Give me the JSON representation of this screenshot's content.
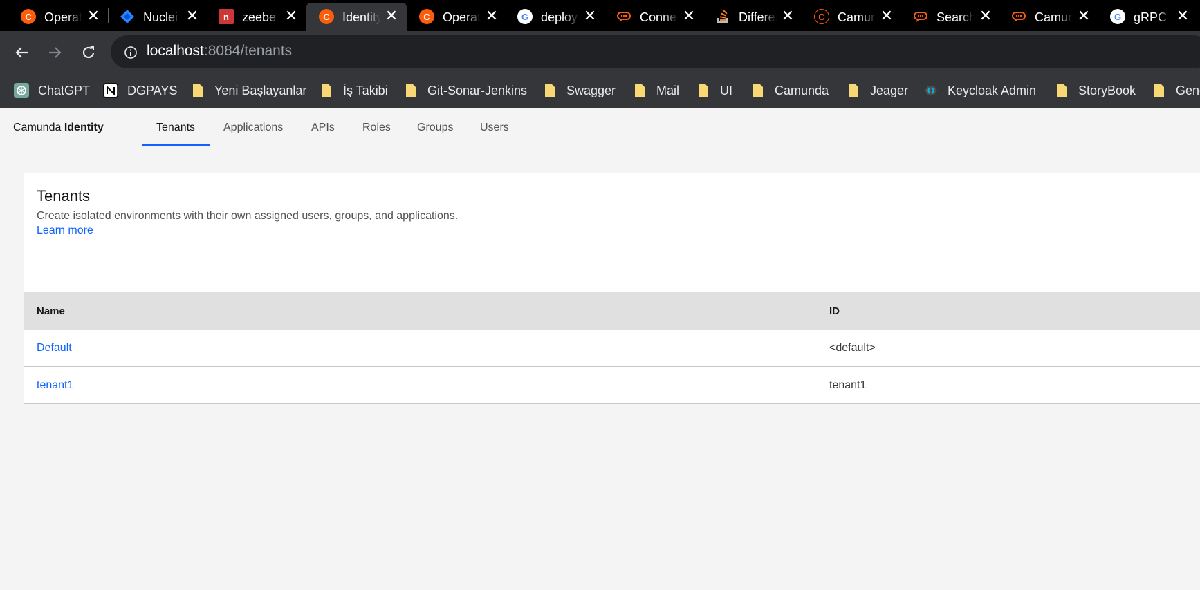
{
  "browser": {
    "tabs": [
      {
        "title": "Operate",
        "icon": "camunda-icon",
        "color": "#fc5d0d"
      },
      {
        "title": "Nuclei",
        "icon": "jira-icon",
        "color": "#2684ff"
      },
      {
        "title": "zeebe",
        "icon": "npm-icon",
        "color": "#cb3837"
      },
      {
        "title": "Identity",
        "icon": "camunda-icon",
        "color": "#fc5d0d",
        "active": true
      },
      {
        "title": "Operate",
        "icon": "camunda-icon",
        "color": "#fc5d0d"
      },
      {
        "title": "deploy",
        "icon": "google-icon",
        "color": "#4285f4"
      },
      {
        "title": "Connectors",
        "icon": "forum-icon",
        "color": "#fc5d0d"
      },
      {
        "title": "Difference",
        "icon": "stackoverflow-icon",
        "color": "#f48024"
      },
      {
        "title": "Camunda",
        "icon": "camunda-icon",
        "color": "#fc5d0d"
      },
      {
        "title": "Search",
        "icon": "forum-icon",
        "color": "#fc5d0d"
      },
      {
        "title": "Camunda",
        "icon": "forum-icon",
        "color": "#fc5d0d"
      },
      {
        "title": "gRPC",
        "icon": "google-icon",
        "color": "#4285f4"
      }
    ],
    "url_host": "localhost",
    "url_path": ":8084/tenants"
  },
  "bookmarks": [
    {
      "label": "ChatGPT",
      "icon": "chatgpt-icon"
    },
    {
      "label": "DGPAYS",
      "icon": "notion-icon"
    },
    {
      "label": "Yeni Başlayanlar",
      "icon": "folder-icon"
    },
    {
      "label": "İş Takibi",
      "icon": "folder-icon"
    },
    {
      "label": "Git-Sonar-Jenkins",
      "icon": "folder-icon"
    },
    {
      "label": "Swagger",
      "icon": "folder-icon"
    },
    {
      "label": "Mail",
      "icon": "folder-icon"
    },
    {
      "label": "UI",
      "icon": "folder-icon"
    },
    {
      "label": "Camunda",
      "icon": "folder-icon"
    },
    {
      "label": "Jeager",
      "icon": "folder-icon"
    },
    {
      "label": "Keycloak Admin",
      "icon": "keycloak-icon"
    },
    {
      "label": "StoryBook",
      "icon": "folder-icon"
    },
    {
      "label": "General",
      "icon": "folder-icon"
    }
  ],
  "app": {
    "brand_prefix": "Camunda",
    "brand_name": "Identity",
    "nav": [
      "Tenants",
      "Applications",
      "APIs",
      "Roles",
      "Groups",
      "Users"
    ],
    "active_nav": "Tenants"
  },
  "page": {
    "title": "Tenants",
    "description": "Create isolated environments with their own assigned users, groups, and applications.",
    "learn_more": "Learn more"
  },
  "table": {
    "columns": [
      "Name",
      "ID"
    ],
    "rows": [
      {
        "name": "Default",
        "id": "<default>"
      },
      {
        "name": "tenant1",
        "id": "tenant1"
      }
    ]
  },
  "colors": {
    "accent": "#0f62fe",
    "folder": "#f8d775"
  }
}
